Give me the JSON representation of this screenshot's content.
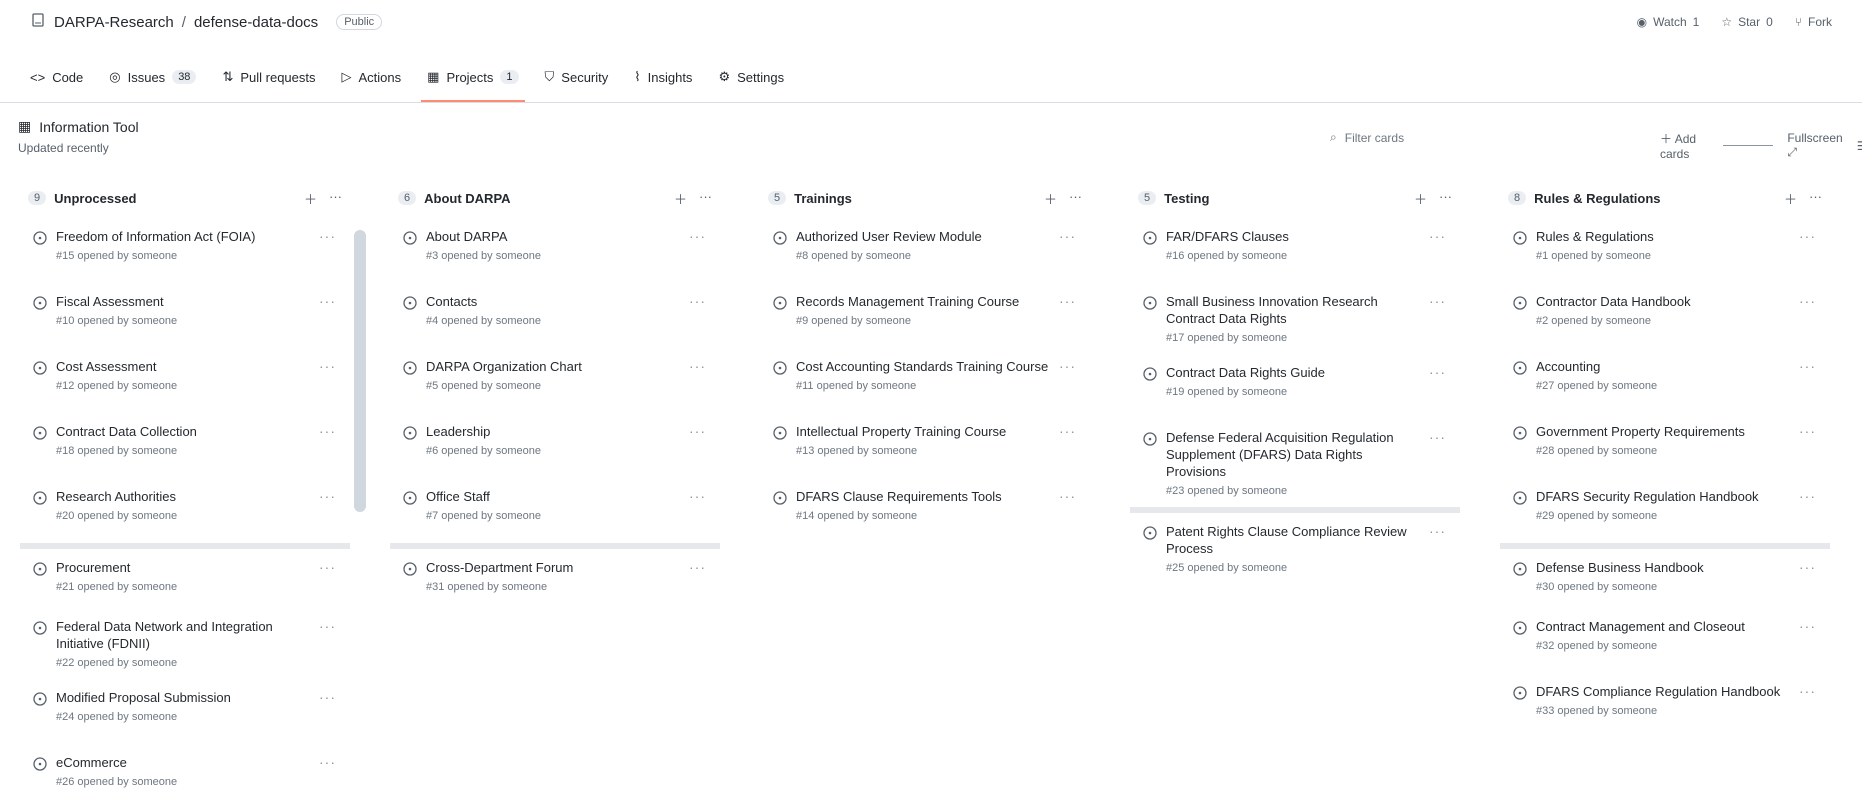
{
  "repo": {
    "owner": "DARPA-Research",
    "name": "defense-data-docs",
    "badge": "Public"
  },
  "top_actions": [
    {
      "label": "Watch",
      "count": "1"
    },
    {
      "label": "Star",
      "count": "0"
    },
    {
      "label": "Fork",
      "count": ""
    }
  ],
  "tabs": [
    {
      "label": "Code",
      "count": ""
    },
    {
      "label": "Issues",
      "count": "38"
    },
    {
      "label": "Pull requests",
      "count": ""
    },
    {
      "label": "Actions",
      "count": ""
    },
    {
      "label": "Projects",
      "count": "1"
    },
    {
      "label": "Security",
      "count": ""
    },
    {
      "label": "Insights",
      "count": ""
    },
    {
      "label": "Settings",
      "count": ""
    }
  ],
  "project": {
    "title": "Information Tool",
    "subtitle": "Updated recently"
  },
  "filter": {
    "label": "Filter cards"
  },
  "view_controls": {
    "label1": "Add cards",
    "label2": "Fullscreen"
  },
  "columns": [
    {
      "name": "Unprocessed",
      "count": "9",
      "cards": [
        {
          "title": "Freedom of Information Act (FOIA)",
          "meta": "#15 opened by someone",
          "menu": "···",
          "sep": false
        },
        {
          "title": "Fiscal Assessment",
          "meta": "#10 opened by someone",
          "menu": "···",
          "sep": false
        },
        {
          "title": "Cost Assessment",
          "meta": "#12 opened by someone",
          "menu": "···",
          "sep": false
        },
        {
          "title": "Contract Data Collection",
          "meta": "#18 opened by someone",
          "menu": "···",
          "sep": false
        },
        {
          "title": "Research Authorities",
          "meta": "#20 opened by someone",
          "menu": "···",
          "sep": false
        },
        {
          "title": "Procurement",
          "meta": "#21 opened by someone",
          "menu": "···",
          "sep": true
        },
        {
          "title": "Federal Data Network and Integration Initiative (FDNII)",
          "meta": "#22 opened by someone",
          "menu": "···",
          "sep": false
        },
        {
          "title": "Modified Proposal Submission",
          "meta": "#24 opened by someone",
          "menu": "···",
          "sep": false
        },
        {
          "title": "eCommerce",
          "meta": "#26 opened by someone",
          "menu": "···",
          "sep": false
        }
      ]
    },
    {
      "name": "About DARPA",
      "count": "6",
      "cards": [
        {
          "title": "About DARPA",
          "meta": "#3 opened by someone",
          "menu": "···",
          "sep": false
        },
        {
          "title": "Contacts",
          "meta": "#4 opened by someone",
          "menu": "···",
          "sep": false
        },
        {
          "title": "DARPA Organization Chart",
          "meta": "#5 opened by someone",
          "menu": "···",
          "sep": false
        },
        {
          "title": "Leadership",
          "meta": "#6 opened by someone",
          "menu": "···",
          "sep": false
        },
        {
          "title": "Office Staff",
          "meta": "#7 opened by someone",
          "menu": "···",
          "sep": false
        },
        {
          "title": "Cross-Department Forum",
          "meta": "#31 opened by someone",
          "menu": "···",
          "sep": true
        }
      ]
    },
    {
      "name": "Trainings",
      "count": "5",
      "cards": [
        {
          "title": "Authorized User Review Module",
          "meta": "#8 opened by someone",
          "menu": "···",
          "sep": false
        },
        {
          "title": "Records Management Training Course",
          "meta": "#9 opened by someone",
          "menu": "···",
          "sep": false
        },
        {
          "title": "Cost Accounting Standards Training Course",
          "meta": "#11 opened by someone",
          "menu": "···",
          "sep": false
        },
        {
          "title": "Intellectual Property Training Course",
          "meta": "#13 opened by someone",
          "menu": "···",
          "sep": false
        },
        {
          "title": "DFARS Clause Requirements Tools",
          "meta": "#14 opened by someone",
          "menu": "···",
          "sep": false
        }
      ]
    },
    {
      "name": "Testing",
      "count": "5",
      "cards": [
        {
          "title": "FAR/DFARS Clauses",
          "meta": "#16 opened by someone",
          "menu": "···",
          "sep": false
        },
        {
          "title": "Small Business Innovation Research Contract Data Rights",
          "meta": "#17 opened by someone",
          "menu": "···",
          "sep": false
        },
        {
          "title": "Contract Data Rights Guide",
          "meta": "#19 opened by someone",
          "menu": "···",
          "sep": false
        },
        {
          "title": "Defense Federal Acquisition Regulation Supplement (DFARS) Data Rights Provisions",
          "meta": "#23 opened by someone",
          "menu": "···",
          "sep": false
        },
        {
          "title": "Patent Rights Clause Compliance Review Process",
          "meta": "#25 opened by someone",
          "menu": "···",
          "sep": true
        }
      ]
    },
    {
      "name": "Rules & Regulations",
      "count": "8",
      "cards": [
        {
          "title": "Rules & Regulations",
          "meta": "#1 opened by someone",
          "menu": "···",
          "sep": false
        },
        {
          "title": "Contractor Data Handbook",
          "meta": "#2 opened by someone",
          "menu": "···",
          "sep": false
        },
        {
          "title": "Accounting",
          "meta": "#27 opened by someone",
          "menu": "···",
          "sep": false
        },
        {
          "title": "Government Property Requirements",
          "meta": "#28 opened by someone",
          "menu": "···",
          "sep": false
        },
        {
          "title": "DFARS Security Regulation Handbook",
          "meta": "#29 opened by someone",
          "menu": "···",
          "sep": false
        },
        {
          "title": "Defense Business Handbook",
          "meta": "#30 opened by someone",
          "menu": "···",
          "sep": true
        },
        {
          "title": "Contract Management and Closeout",
          "meta": "#32 opened by someone",
          "menu": "···",
          "sep": false
        },
        {
          "title": "DFARS Compliance Regulation Handbook",
          "meta": "#33 opened by someone",
          "menu": "···",
          "sep": false
        }
      ]
    }
  ]
}
